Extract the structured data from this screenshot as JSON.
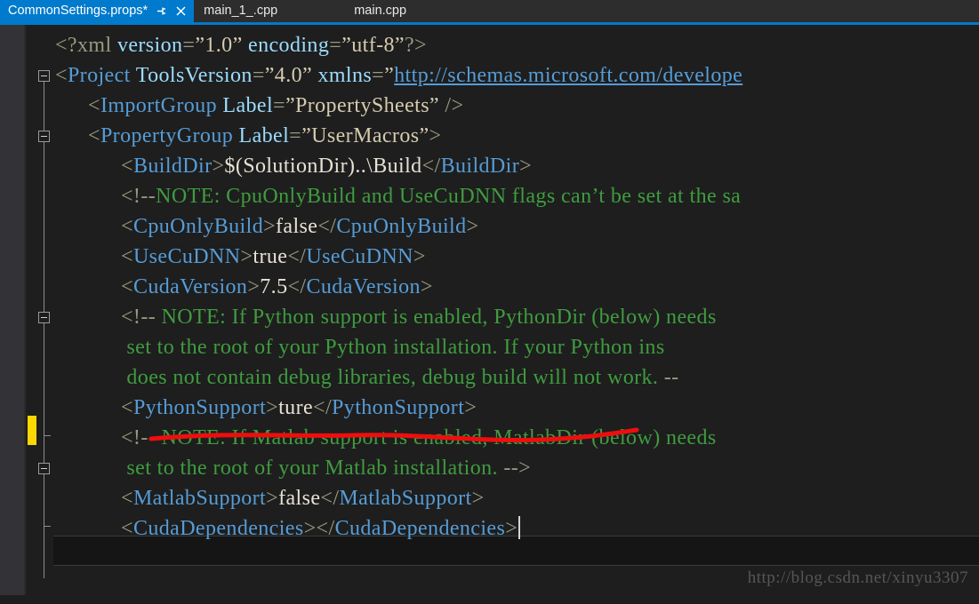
{
  "window": {
    "app": "Visual Studio",
    "accent_color": "#007acc",
    "editor_bg": "#1e1e1e"
  },
  "tabs": [
    {
      "label": "CommonSettings.props*",
      "active": true,
      "pin_icon": "pin-icon",
      "close_icon": "close-icon"
    },
    {
      "label": "main_1_.cpp",
      "active": false
    },
    {
      "label": "main.cpp",
      "active": false
    }
  ],
  "code": {
    "language": "xml",
    "lines": [
      {
        "n": 1,
        "indent": 0,
        "segments": [
          {
            "t": "<?xml ",
            "c": "punct"
          },
          {
            "t": "version",
            "c": "attr"
          },
          {
            "t": "=",
            "c": "punct"
          },
          {
            "t": "”1.0”",
            "c": "str"
          },
          {
            "t": " ",
            "c": "punct"
          },
          {
            "t": "encoding",
            "c": "attr"
          },
          {
            "t": "=",
            "c": "punct"
          },
          {
            "t": "”utf-8”",
            "c": "str"
          },
          {
            "t": "?>",
            "c": "punct"
          }
        ]
      },
      {
        "n": 2,
        "indent": 0,
        "segments": [
          {
            "t": "<",
            "c": "punct"
          },
          {
            "t": "Project",
            "c": "tag"
          },
          {
            "t": " ",
            "c": "punct"
          },
          {
            "t": "ToolsVersion",
            "c": "attr"
          },
          {
            "t": "=",
            "c": "punct"
          },
          {
            "t": "”4.0”",
            "c": "str"
          },
          {
            "t": " ",
            "c": "punct"
          },
          {
            "t": "xmlns",
            "c": "attr"
          },
          {
            "t": "=",
            "c": "punct"
          },
          {
            "t": "”",
            "c": "str"
          },
          {
            "t": "http://schemas.microsoft.com/develope",
            "c": "url"
          }
        ]
      },
      {
        "n": 3,
        "indent": 1,
        "segments": [
          {
            "t": "<",
            "c": "punct"
          },
          {
            "t": "ImportGroup",
            "c": "tag"
          },
          {
            "t": " ",
            "c": "punct"
          },
          {
            "t": "Label",
            "c": "attr"
          },
          {
            "t": "=",
            "c": "punct"
          },
          {
            "t": "”PropertySheets”",
            "c": "str"
          },
          {
            "t": " />",
            "c": "punct"
          }
        ]
      },
      {
        "n": 4,
        "indent": 1,
        "segments": [
          {
            "t": "<",
            "c": "punct"
          },
          {
            "t": "PropertyGroup",
            "c": "tag"
          },
          {
            "t": " ",
            "c": "punct"
          },
          {
            "t": "Label",
            "c": "attr"
          },
          {
            "t": "=",
            "c": "punct"
          },
          {
            "t": "”UserMacros”",
            "c": "str"
          },
          {
            "t": ">",
            "c": "punct"
          }
        ]
      },
      {
        "n": 5,
        "indent": 2,
        "segments": [
          {
            "t": "<",
            "c": "punct"
          },
          {
            "t": "BuildDir",
            "c": "tag"
          },
          {
            "t": ">",
            "c": "punct"
          },
          {
            "t": "$(SolutionDir)..\\Build",
            "c": "val"
          },
          {
            "t": "</",
            "c": "punct"
          },
          {
            "t": "BuildDir",
            "c": "tag"
          },
          {
            "t": ">",
            "c": "punct"
          }
        ]
      },
      {
        "n": 6,
        "indent": 2,
        "segments": [
          {
            "t": "<!--",
            "c": "punct"
          },
          {
            "t": "NOTE: CpuOnlyBuild and UseCuDNN flags can’t be set at the sa",
            "c": "comment"
          }
        ]
      },
      {
        "n": 7,
        "indent": 2,
        "segments": [
          {
            "t": "<",
            "c": "punct"
          },
          {
            "t": "CpuOnlyBuild",
            "c": "tag"
          },
          {
            "t": ">",
            "c": "punct"
          },
          {
            "t": "false",
            "c": "val"
          },
          {
            "t": "</",
            "c": "punct"
          },
          {
            "t": "CpuOnlyBuild",
            "c": "tag"
          },
          {
            "t": ">",
            "c": "punct"
          }
        ]
      },
      {
        "n": 8,
        "indent": 2,
        "segments": [
          {
            "t": "<",
            "c": "punct"
          },
          {
            "t": "UseCuDNN",
            "c": "tag"
          },
          {
            "t": ">",
            "c": "punct"
          },
          {
            "t": "true",
            "c": "val"
          },
          {
            "t": "</",
            "c": "punct"
          },
          {
            "t": "UseCuDNN",
            "c": "tag"
          },
          {
            "t": ">",
            "c": "punct"
          }
        ]
      },
      {
        "n": 9,
        "indent": 2,
        "segments": [
          {
            "t": "<",
            "c": "punct"
          },
          {
            "t": "CudaVersion",
            "c": "tag"
          },
          {
            "t": ">",
            "c": "punct"
          },
          {
            "t": "7.5",
            "c": "val"
          },
          {
            "t": "</",
            "c": "punct"
          },
          {
            "t": "CudaVersion",
            "c": "tag"
          },
          {
            "t": ">",
            "c": "punct"
          }
        ]
      },
      {
        "n": 10,
        "indent": 2,
        "segments": [
          {
            "t": "<!--",
            "c": "punct"
          },
          {
            "t": " NOTE: If Python support is enabled, PythonDir (below) needs",
            "c": "comment"
          }
        ]
      },
      {
        "n": 11,
        "indent": 2,
        "segments": [
          {
            "t": " set to the root of your Python installation. If your Python ins",
            "c": "comment"
          }
        ]
      },
      {
        "n": 12,
        "indent": 2,
        "segments": [
          {
            "t": " does not contain debug libraries, debug build will not work. ",
            "c": "comment"
          },
          {
            "t": "--",
            "c": "punct"
          }
        ]
      },
      {
        "n": 13,
        "indent": 2,
        "segments": [
          {
            "t": "<",
            "c": "punct"
          },
          {
            "t": "PythonSupport",
            "c": "tag"
          },
          {
            "t": ">",
            "c": "punct"
          },
          {
            "t": "ture",
            "c": "val"
          },
          {
            "t": "</",
            "c": "punct"
          },
          {
            "t": "PythonSupport",
            "c": "tag"
          },
          {
            "t": ">",
            "c": "punct"
          }
        ]
      },
      {
        "n": 14,
        "indent": 2,
        "segments": [
          {
            "t": "<!--",
            "c": "punct"
          },
          {
            "t": " NOTE: If Matlab support is enabled, MatlabDir (below) needs",
            "c": "comment"
          }
        ]
      },
      {
        "n": 15,
        "indent": 2,
        "segments": [
          {
            "t": " set to the root of your Matlab installation. ",
            "c": "comment"
          },
          {
            "t": "-->",
            "c": "punct"
          }
        ]
      },
      {
        "n": 16,
        "indent": 2,
        "segments": [
          {
            "t": "<",
            "c": "punct"
          },
          {
            "t": "MatlabSupport",
            "c": "tag"
          },
          {
            "t": ">",
            "c": "punct"
          },
          {
            "t": "false",
            "c": "val"
          },
          {
            "t": "</",
            "c": "punct"
          },
          {
            "t": "MatlabSupport",
            "c": "tag"
          },
          {
            "t": ">",
            "c": "punct"
          }
        ]
      },
      {
        "n": 17,
        "indent": 2,
        "current": true,
        "caret": true,
        "segments": [
          {
            "t": "<",
            "c": "punct"
          },
          {
            "t": "CudaDependencies",
            "c": "tag"
          },
          {
            "t": ">",
            "c": "punct"
          },
          {
            "t": "</",
            "c": "punct"
          },
          {
            "t": "CudaDependencies",
            "c": "tag"
          },
          {
            "t": ">",
            "c": "punct"
          }
        ]
      }
    ]
  },
  "gutter": {
    "collapse_boxes": [
      {
        "line": 2,
        "icon": "collapse-minus-icon"
      },
      {
        "line": 4,
        "icon": "collapse-minus-icon"
      },
      {
        "line": 10,
        "icon": "collapse-minus-icon"
      },
      {
        "line": 14,
        "icon": "collapse-minus-icon"
      }
    ],
    "change_marker": {
      "line": 13,
      "color": "#fdd800"
    }
  },
  "annotation": {
    "underline_color": "#ee0000",
    "target_line": 13,
    "description": "red hand-drawn underline under PythonSupport element"
  },
  "watermark": {
    "text": "http://blog.csdn.net/xinyu3307"
  }
}
